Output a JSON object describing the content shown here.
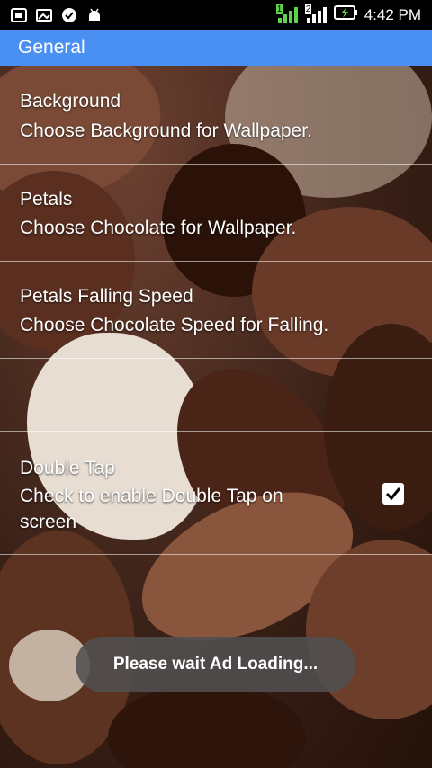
{
  "status_bar": {
    "time": "4:42 PM",
    "sim1": "1",
    "sim2": "2"
  },
  "header": {
    "title": "General"
  },
  "settings": [
    {
      "title": "Background",
      "subtitle": "Choose Background for Wallpaper."
    },
    {
      "title": "Petals",
      "subtitle": "Choose Chocolate for Wallpaper."
    },
    {
      "title": "Petals Falling Speed",
      "subtitle": "Choose Chocolate Speed for Falling."
    },
    {
      "title": "Double Tap",
      "subtitle_line1": "Check to enable Double Tap on",
      "subtitle_line2": "screen",
      "checked": true
    }
  ],
  "toast": "Please wait Ad Loading...",
  "colors": {
    "header": "#4a8ff2",
    "status_bar": "#000000",
    "battery_charge": "#5fd34a"
  }
}
